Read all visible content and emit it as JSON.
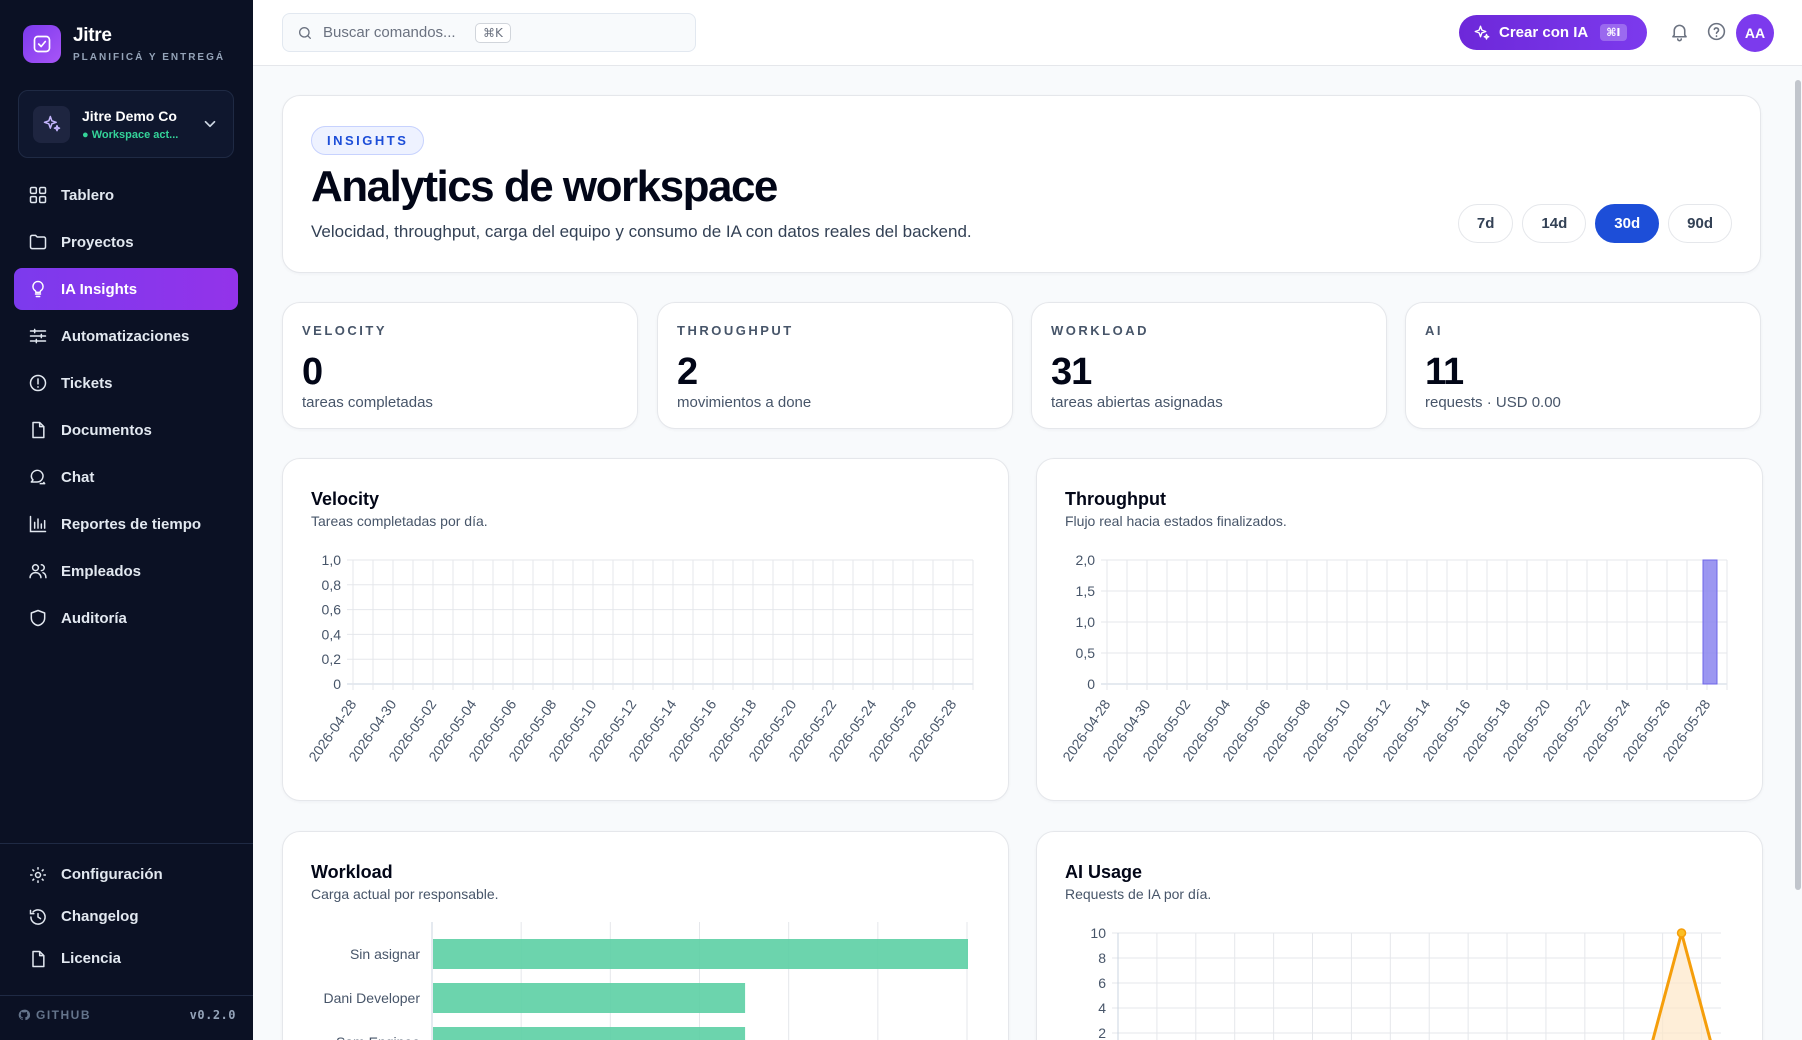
{
  "brand": {
    "name": "Jitre",
    "tagline": "PLANIFICÁ Y ENTREGÁ"
  },
  "workspace": {
    "name": "Jitre Demo Co",
    "status": "● Workspace act..."
  },
  "sidebar": {
    "items": [
      {
        "label": "Tablero",
        "icon": "grid-icon"
      },
      {
        "label": "Proyectos",
        "icon": "folder-icon"
      },
      {
        "label": "IA Insights",
        "icon": "lightbulb-icon",
        "active": true
      },
      {
        "label": "Automatizaciones",
        "icon": "sliders-icon"
      },
      {
        "label": "Tickets",
        "icon": "alert-circle-icon"
      },
      {
        "label": "Documentos",
        "icon": "document-icon"
      },
      {
        "label": "Chat",
        "icon": "chat-icon"
      },
      {
        "label": "Reportes de tiempo",
        "icon": "bar-chart-icon"
      },
      {
        "label": "Empleados",
        "icon": "users-icon"
      },
      {
        "label": "Auditoría",
        "icon": "shield-icon"
      }
    ],
    "bottom_items": [
      {
        "label": "Configuración",
        "icon": "gear-icon"
      },
      {
        "label": "Changelog",
        "icon": "history-icon"
      },
      {
        "label": "Licencia",
        "icon": "document-icon"
      }
    ],
    "footer": {
      "github": "GITHUB",
      "version": "v0.2.0"
    }
  },
  "topbar": {
    "search_placeholder": "Buscar comandos...",
    "search_shortcut": "⌘K",
    "ai_button": "Crear con IA",
    "ai_shortcut": "⌘I",
    "avatar_initials": "AA"
  },
  "hero": {
    "pill": "INSIGHTS",
    "title": "Analytics de workspace",
    "subtitle": "Velocidad, throughput, carga del equipo y consumo de IA con datos reales del backend.",
    "ranges": [
      "7d",
      "14d",
      "30d",
      "90d"
    ],
    "active_range": "30d"
  },
  "stats": [
    {
      "label": "VELOCITY",
      "value": "0",
      "sub": "tareas completadas"
    },
    {
      "label": "THROUGHPUT",
      "value": "2",
      "sub": "movimientos a done"
    },
    {
      "label": "WORKLOAD",
      "value": "31",
      "sub": "tareas abiertas asignadas"
    },
    {
      "label": "AI",
      "value": "11",
      "sub": "requests · USD 0.00"
    }
  ],
  "charts": {
    "velocity": {
      "title": "Velocity",
      "subtitle": "Tareas completadas por día."
    },
    "throughput": {
      "title": "Throughput",
      "subtitle": "Flujo real hacia estados finalizados."
    },
    "workload": {
      "title": "Workload",
      "subtitle": "Carga actual por responsable."
    },
    "ai_usage": {
      "title": "AI Usage",
      "subtitle": "Requests de IA por día."
    }
  },
  "colors": {
    "accent": "#7c3aed",
    "primary_blue": "#1d4ed8",
    "sidebar_bg": "#0b1124",
    "workload_bar": "#5ccfa4",
    "throughput_bar": "#8b85ee",
    "ai_line": "#f59e0b"
  },
  "chart_data": [
    {
      "type": "line",
      "title": "Velocity",
      "x_tick_labels": [
        "2026-04-28",
        "2026-04-30",
        "2026-05-02",
        "2026-05-04",
        "2026-05-06",
        "2026-05-08",
        "2026-05-10",
        "2026-05-12",
        "2026-05-14",
        "2026-05-16",
        "2026-05-18",
        "2026-05-20",
        "2026-05-22",
        "2026-05-24",
        "2026-05-26",
        "2026-05-28"
      ],
      "y_tick_labels": [
        "0",
        "0,2",
        "0,4",
        "0,6",
        "0,8",
        "1,0"
      ],
      "ylim": [
        0,
        1
      ],
      "series": [],
      "grid": true
    },
    {
      "type": "bar",
      "title": "Throughput",
      "x_tick_labels": [
        "2026-04-28",
        "2026-04-30",
        "2026-05-02",
        "2026-05-04",
        "2026-05-06",
        "2026-05-08",
        "2026-05-10",
        "2026-05-12",
        "2026-05-14",
        "2026-05-16",
        "2026-05-18",
        "2026-05-20",
        "2026-05-22",
        "2026-05-24",
        "2026-05-26",
        "2026-05-28"
      ],
      "y_tick_labels": [
        "0",
        "0,5",
        "1,0",
        "1,5",
        "2,0"
      ],
      "ylim": [
        0,
        2
      ],
      "bars": [
        {
          "x": "2026-05-28",
          "value": 2
        }
      ],
      "grid": true
    },
    {
      "type": "bar",
      "orientation": "horizontal",
      "title": "Workload",
      "categories": [
        "Sin asignar",
        "Dani Developer",
        "Sam Enginee"
      ],
      "values": [
        12,
        7,
        7
      ],
      "xlim": [
        0,
        12
      ],
      "grid": true
    },
    {
      "type": "area",
      "title": "AI Usage",
      "y_tick_labels": [
        "2",
        "4",
        "6",
        "8",
        "10"
      ],
      "ylim": [
        0,
        10
      ],
      "peak": {
        "value": 10,
        "position": "second to last day"
      },
      "grid": true
    }
  ]
}
